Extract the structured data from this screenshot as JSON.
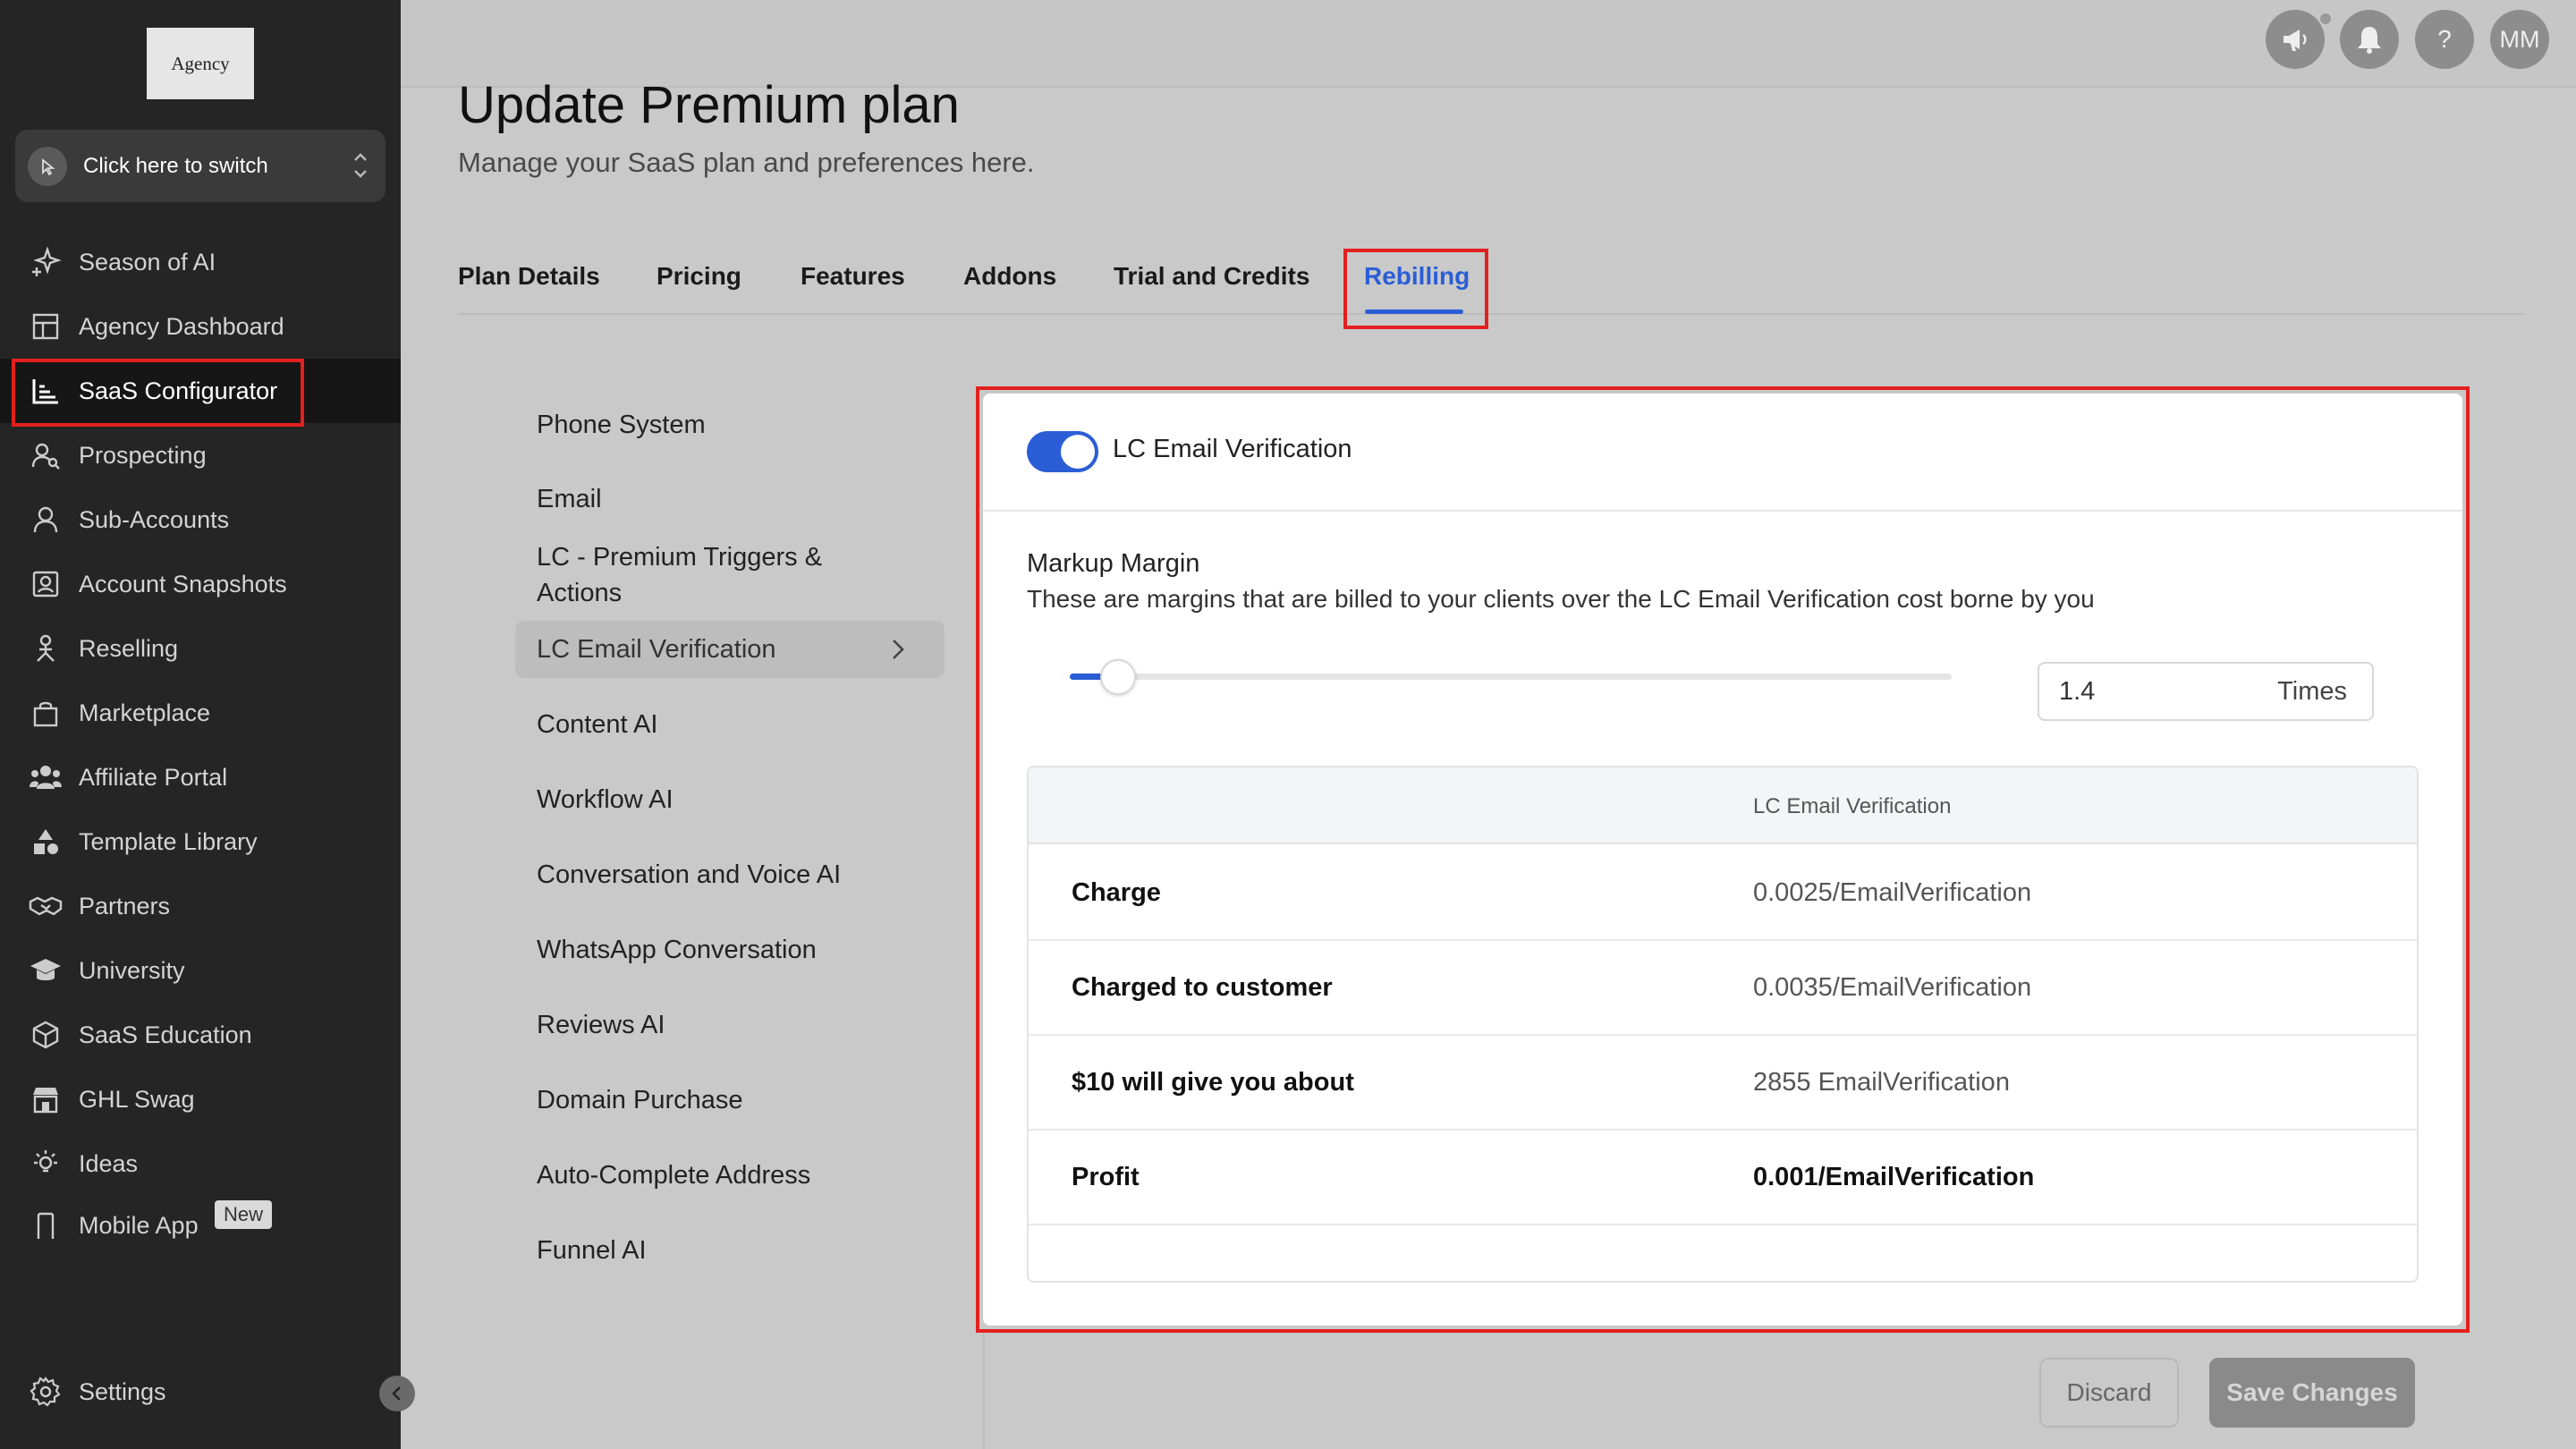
{
  "sidebar": {
    "logo_text": "Agency",
    "switcher_label": "Click here to switch",
    "items": [
      {
        "label": "Season of AI",
        "icon": "sparkle-icon"
      },
      {
        "label": "Agency Dashboard",
        "icon": "dashboard-icon"
      },
      {
        "label": "SaaS Configurator",
        "icon": "chart-bars-icon"
      },
      {
        "label": "Prospecting",
        "icon": "prospecting-icon"
      },
      {
        "label": "Sub-Accounts",
        "icon": "user-icon"
      },
      {
        "label": "Account Snapshots",
        "icon": "snapshot-icon"
      },
      {
        "label": "Reselling",
        "icon": "reselling-icon"
      },
      {
        "label": "Marketplace",
        "icon": "bag-icon"
      },
      {
        "label": "Affiliate Portal",
        "icon": "people-icon"
      },
      {
        "label": "Template Library",
        "icon": "shapes-icon"
      },
      {
        "label": "Partners",
        "icon": "handshake-icon"
      },
      {
        "label": "University",
        "icon": "graduation-cap-icon"
      },
      {
        "label": "SaaS Education",
        "icon": "cube-icon"
      },
      {
        "label": "GHL Swag",
        "icon": "store-icon"
      },
      {
        "label": "Ideas",
        "icon": "lightbulb-icon"
      },
      {
        "label": "Mobile App",
        "icon": "mobile-icon"
      }
    ],
    "new_badge": "New",
    "settings_label": "Settings"
  },
  "topbar": {
    "avatar_initials": "MM",
    "help_symbol": "?"
  },
  "page": {
    "title": "Update Premium plan",
    "subtitle": "Manage your SaaS plan and preferences here."
  },
  "tabs": [
    "Plan Details",
    "Pricing",
    "Features",
    "Addons",
    "Trial and Credits",
    "Rebilling"
  ],
  "active_tab": "Rebilling",
  "subnav": [
    "Phone System",
    "Email",
    "LC - Premium Triggers & Actions",
    "LC Email Verification",
    "Content AI",
    "Workflow AI",
    "Conversation and Voice AI",
    "WhatsApp Conversation",
    "Reviews AI",
    "Domain Purchase",
    "Auto-Complete Address",
    "Funnel AI"
  ],
  "panel": {
    "toggle_label": "LC Email Verification",
    "toggle_on": true,
    "markup_title": "Markup Margin",
    "markup_desc": "These are margins that are billed to your clients over the LC Email Verification cost borne by you",
    "markup_value": "1.4",
    "markup_unit": "Times",
    "slider_fraction": 0.06,
    "table_header": "LC Email Verification",
    "rows": [
      {
        "label": "Charge",
        "value": "0.0025/EmailVerification"
      },
      {
        "label": "Charged to customer",
        "value": "0.0035/EmailVerification"
      },
      {
        "label": "$10 will give you about",
        "value": "2855 EmailVerification"
      },
      {
        "label": "Profit",
        "value": "0.001/EmailVerification"
      }
    ]
  },
  "buttons": {
    "discard": "Discard",
    "save": "Save Changes"
  },
  "colors": {
    "accent": "#2b5dd6",
    "highlight_box": "#e3201f"
  }
}
